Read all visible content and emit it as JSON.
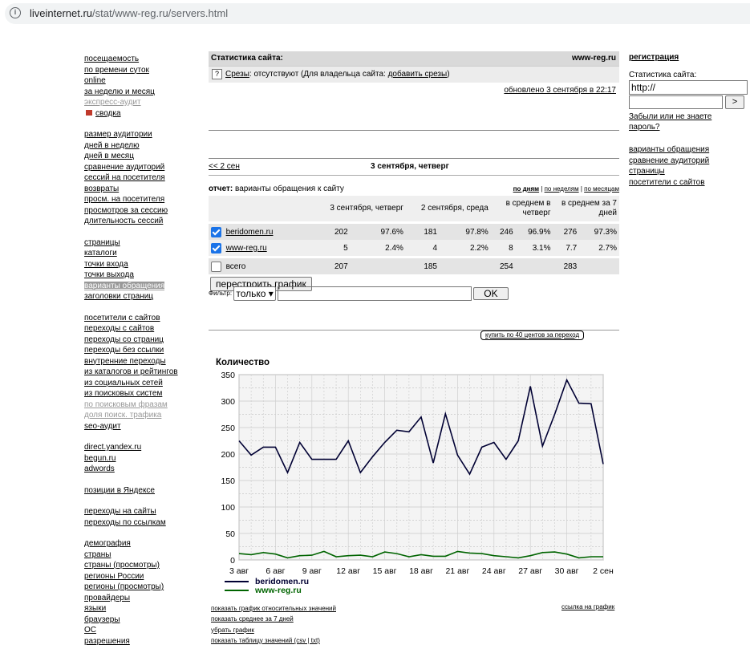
{
  "browser": {
    "url_host": "liveinternet.ru",
    "url_path": "/stat/www-reg.ru/servers.html"
  },
  "leftnav": {
    "groups": [
      [
        {
          "label": "посещаемость",
          "style": "link"
        },
        {
          "label": "по времени суток",
          "style": "link"
        },
        {
          "label": "online",
          "style": "link"
        },
        {
          "label": "за неделю и месяц",
          "style": "link"
        },
        {
          "label": "экспресс-аудит",
          "style": "gray"
        },
        {
          "label": "сводка",
          "style": "marked"
        }
      ],
      [
        {
          "label": "размер аудитории",
          "style": "link"
        },
        {
          "label": "дней в неделю",
          "style": "link"
        },
        {
          "label": "дней в месяц",
          "style": "link"
        },
        {
          "label": "сравнение аудиторий",
          "style": "link"
        },
        {
          "label": "сессий на посетителя",
          "style": "link"
        },
        {
          "label": "возвраты",
          "style": "link"
        },
        {
          "label": "просм. на посетителя",
          "style": "link"
        },
        {
          "label": "просмотров за сессию",
          "style": "link"
        },
        {
          "label": "длительность сессий",
          "style": "link"
        }
      ],
      [
        {
          "label": "страницы",
          "style": "link"
        },
        {
          "label": "каталоги",
          "style": "link"
        },
        {
          "label": "точки входа",
          "style": "link"
        },
        {
          "label": "точки выхода",
          "style": "link"
        },
        {
          "label": "варианты обращения",
          "style": "selected"
        },
        {
          "label": "заголовки страниц",
          "style": "link"
        }
      ],
      [
        {
          "label": "посетители с сайтов",
          "style": "link"
        },
        {
          "label": "переходы с сайтов",
          "style": "link"
        },
        {
          "label": "переходы со страниц",
          "style": "link"
        },
        {
          "label": "переходы без ссылки",
          "style": "link"
        },
        {
          "label": "внутренние переходы",
          "style": "link"
        },
        {
          "label": "из каталогов и рейтингов",
          "style": "link"
        },
        {
          "label": "из социальных сетей",
          "style": "link"
        },
        {
          "label": "из поисковых систем",
          "style": "link"
        },
        {
          "label": "по поисковым фразам",
          "style": "gray"
        },
        {
          "label": "доля поиск. трафика",
          "style": "gray"
        },
        {
          "label": "seo-аудит",
          "style": "link"
        }
      ],
      [
        {
          "label": "direct.yandex.ru",
          "style": "link"
        },
        {
          "label": "begun.ru",
          "style": "link"
        },
        {
          "label": "adwords",
          "style": "link"
        }
      ],
      [
        {
          "label": "позиции в Яндексе",
          "style": "link"
        }
      ],
      [
        {
          "label": "переходы на сайты",
          "style": "link"
        },
        {
          "label": "переходы по ссылкам",
          "style": "link"
        }
      ],
      [
        {
          "label": "демография",
          "style": "link"
        },
        {
          "label": "страны",
          "style": "link"
        },
        {
          "label": "страны (просмотры)",
          "style": "link"
        },
        {
          "label": "регионы России",
          "style": "link"
        },
        {
          "label": "регионы (просмотры)",
          "style": "link"
        },
        {
          "label": "провайдеры",
          "style": "link"
        },
        {
          "label": "языки",
          "style": "link"
        },
        {
          "label": "браузеры",
          "style": "link"
        },
        {
          "label": "ОС",
          "style": "link"
        },
        {
          "label": "разрешения",
          "style": "link"
        }
      ]
    ]
  },
  "main": {
    "header_title": "Статистика сайта:",
    "header_site": "www-reg.ru",
    "slices": {
      "link": "Срезы",
      "text": ": отсутствуют (Для владельца сайта: ",
      "add_link": "добавить срезы",
      "tail": ")"
    },
    "updated": "обновлено 3 сентября в 22:17",
    "prev": "<< 2 сен",
    "current_date": "3 сентября, четверг",
    "report_label": "отчет:",
    "report_title": " варианты обращения к сайту",
    "periods": {
      "days": "по дням",
      "weeks": "по неделям",
      "months": "по месяцам",
      "sep": " | "
    },
    "table": {
      "headers": [
        "3 сентября, четверг",
        "2 сентября, среда",
        "в среднем в четверг",
        "в среднем за 7 дней"
      ],
      "rows": [
        {
          "name": "beridomen.ru",
          "checked": true,
          "v1": "202",
          "p1": "97.6%",
          "v2": "181",
          "p2": "97.8%",
          "v3": "246",
          "p3": "96.9%",
          "v4": "276",
          "p4": "97.3%"
        },
        {
          "name": "www-reg.ru",
          "checked": true,
          "v1": "5",
          "p1": "2.4%",
          "v2": "4",
          "p2": "2.2%",
          "v3": "8",
          "p3": "3.1%",
          "v4": "7.7",
          "p4": "2.7%"
        }
      ],
      "total": {
        "name": "всего",
        "checked": false,
        "v1": "207",
        "v2": "185",
        "v3": "254",
        "v4": "283"
      }
    },
    "rebuild_button": "перестроить график",
    "filter_label": "Фильтр:",
    "filter_select": "только",
    "filter_value": "",
    "ok_button": "OK",
    "buy_link": "купить по 40 центов за переход",
    "bottom_links": [
      "показать график относительных значений",
      "показать среднее за 7 дней",
      "убрать график",
      "показать таблицу значений (csv | txt)"
    ],
    "chart_link": "ссылка на график"
  },
  "chart_data": {
    "type": "line",
    "title": "Количество",
    "x_ticks": [
      "3 авг",
      "6 авг",
      "9 авг",
      "12 авг",
      "15 авг",
      "18 авг",
      "21 авг",
      "24 авг",
      "27 авг",
      "30 авг",
      "2 сен"
    ],
    "ylim": [
      0,
      350
    ],
    "y_ticks": [
      0,
      50,
      100,
      150,
      200,
      250,
      300,
      350
    ],
    "grid": true,
    "legend": "bottom-left",
    "series": [
      {
        "name": "beridomen.ru",
        "color": "#000033",
        "values": [
          225,
          198,
          213,
          213,
          165,
          222,
          190,
          190,
          190,
          225,
          165,
          195,
          222,
          245,
          242,
          270,
          183,
          276,
          198,
          162,
          213,
          222,
          190,
          225,
          328,
          215,
          275,
          340,
          296,
          295,
          181
        ]
      },
      {
        "name": "www-reg.ru",
        "color": "#006400",
        "values": [
          12,
          10,
          14,
          11,
          4,
          8,
          9,
          16,
          6,
          8,
          9,
          6,
          15,
          12,
          6,
          10,
          7,
          7,
          16,
          13,
          12,
          8,
          6,
          4,
          8,
          14,
          15,
          11,
          4,
          6,
          6
        ]
      }
    ]
  },
  "rightcol": {
    "register": "регистрация",
    "stat_label": "Статистика сайта:",
    "site_input": "http://",
    "password_input": "",
    "go_button": ">",
    "forgot": "Забыли или не знаете пароль?",
    "links": [
      "варианты обращения",
      "сравнение аудиторий",
      "страницы",
      "посетители с сайтов"
    ]
  }
}
